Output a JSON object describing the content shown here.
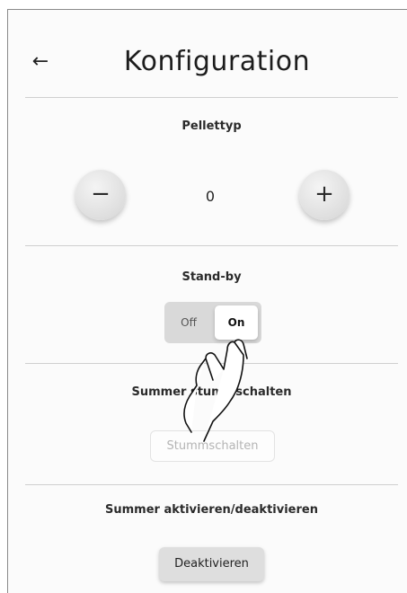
{
  "header": {
    "back_icon": "arrow-left-icon",
    "back_glyph": "←",
    "title": "Konfiguration"
  },
  "pellettyp": {
    "label": "Pellettyp",
    "decrement_glyph": "−",
    "value": "0",
    "increment_glyph": "+"
  },
  "standby": {
    "label": "Stand-by",
    "options": [
      "Off",
      "On"
    ],
    "selected": "On"
  },
  "summer_mute": {
    "label": "Summer stummschalten",
    "button_label": "Stummschalten",
    "button_enabled": false
  },
  "summer_toggle": {
    "label": "Summer aktivieren/deaktivieren",
    "button_label": "Deaktivieren"
  },
  "overlay": {
    "icon": "hand-pointer-icon"
  }
}
